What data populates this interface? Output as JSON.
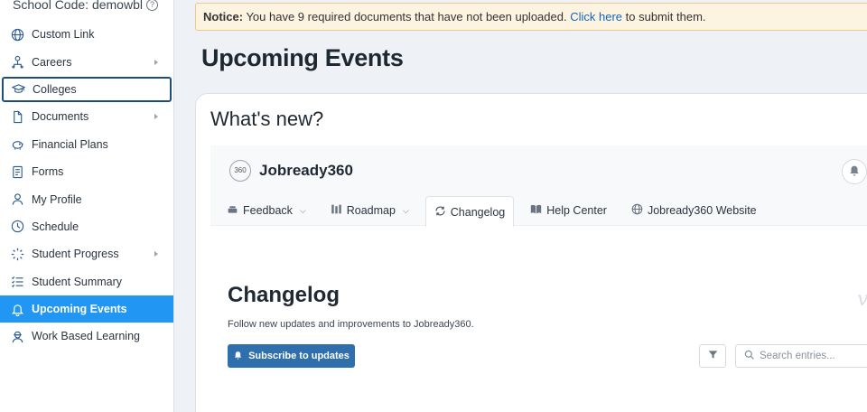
{
  "sidebar": {
    "school_code": "School Code: demowbl",
    "items": [
      {
        "label": "Custom Link",
        "icon": "globe-icon",
        "has_submenu": false
      },
      {
        "label": "Careers",
        "icon": "person-hierarchy-icon",
        "has_submenu": true
      },
      {
        "label": "Colleges",
        "icon": "graduation-cap-icon",
        "has_submenu": false
      },
      {
        "label": "Documents",
        "icon": "document-icon",
        "has_submenu": true
      },
      {
        "label": "Financial Plans",
        "icon": "piggy-bank-icon",
        "has_submenu": false
      },
      {
        "label": "Forms",
        "icon": "form-icon",
        "has_submenu": false
      },
      {
        "label": "My Profile",
        "icon": "user-icon",
        "has_submenu": false
      },
      {
        "label": "Schedule",
        "icon": "clock-icon",
        "has_submenu": false
      },
      {
        "label": "Student Progress",
        "icon": "progress-spinner-icon",
        "has_submenu": true
      },
      {
        "label": "Student Summary",
        "icon": "list-icon",
        "has_submenu": false
      },
      {
        "label": "Upcoming Events",
        "icon": "bell-icon",
        "has_submenu": false
      },
      {
        "label": "Work Based Learning",
        "icon": "worker-icon",
        "has_submenu": false
      }
    ],
    "active_item": "Upcoming Events",
    "focused_item": "Colleges"
  },
  "notice": {
    "prefix": "Notice:",
    "message": "You have 9 required documents that have not been uploaded.",
    "link_text": "Click here",
    "suffix": "to submit them."
  },
  "page_title": "Upcoming Events",
  "card": {
    "heading": "What's new?",
    "widget": {
      "logo_text": "360",
      "brand": "Jobready360",
      "tabs": [
        {
          "label": "Feedback",
          "icon": "megaphone-icon",
          "dropdown": true
        },
        {
          "label": "Roadmap",
          "icon": "roadmap-icon",
          "dropdown": true
        },
        {
          "label": "Changelog",
          "icon": "refresh-icon",
          "dropdown": false
        },
        {
          "label": "Help Center",
          "icon": "book-icon",
          "dropdown": false
        },
        {
          "label": "Jobready360 Website",
          "icon": "globe-icon",
          "dropdown": false
        }
      ],
      "active_tab": "Changelog",
      "changelog_title": "Changelog",
      "changelog_subtitle": "Follow new updates and improvements to Jobready360.",
      "subscribe_label": "Subscribe to updates",
      "search_placeholder": "Search entries..."
    }
  },
  "colors": {
    "active_nav": "#2196f3",
    "notice_bg": "#fdf3e1",
    "notice_border": "#f0c88a",
    "link": "#1565c0",
    "subscribe_button": "#2f6fab"
  }
}
